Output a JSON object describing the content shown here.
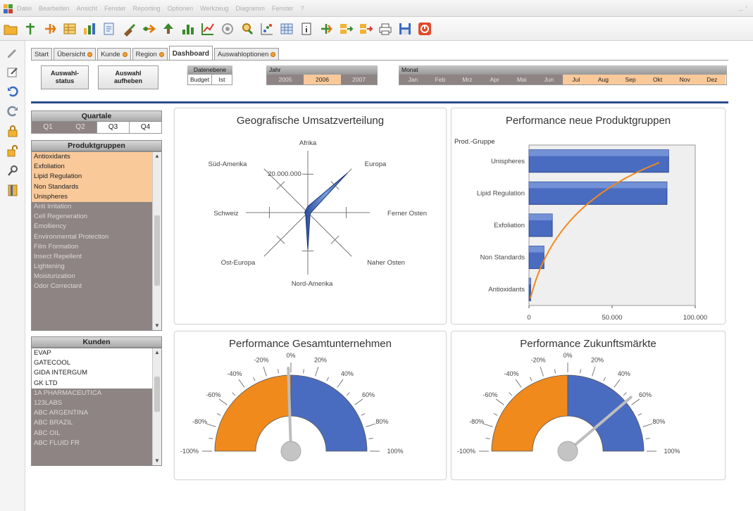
{
  "menubar": {
    "items": [
      "Datei",
      "Bearbeiten",
      "Ansicht",
      "Fenster",
      "Reporting",
      "Optionen",
      "Werkzeug",
      "Diagramm",
      "Fenster",
      "?"
    ],
    "window_controls": "_ ▫"
  },
  "toolbar_icons": [
    "open-folder-icon",
    "pin-icon",
    "tag-icon",
    "table-icon",
    "chart-icon",
    "document-icon",
    "brush-icon",
    "arrows-icon",
    "tree-icon",
    "bar-icon",
    "line-icon",
    "circle-icon",
    "magnify-icon",
    "scatter-icon",
    "grid-icon",
    "info-icon",
    "fork-icon",
    "export-icon",
    "export2-icon",
    "print-icon",
    "save-icon",
    "stop-icon"
  ],
  "tabs": [
    {
      "label": "Start",
      "dot": false,
      "active": false
    },
    {
      "label": "Übersicht",
      "dot": true,
      "active": false
    },
    {
      "label": "Kunde",
      "dot": true,
      "active": false
    },
    {
      "label": "Region",
      "dot": true,
      "active": false
    },
    {
      "label": "Dashboard",
      "dot": false,
      "active": true
    },
    {
      "label": "Auswahloptionen",
      "dot": true,
      "active": false
    }
  ],
  "buttons": {
    "auswahlstatus": "Auswahl-\nstatus",
    "auswahl_aufheben": "Auswahl\naufheben"
  },
  "datenebene": {
    "title": "Datenebene",
    "options": [
      "Budget",
      "Ist"
    ]
  },
  "jahr": {
    "title": "Jahr",
    "options": [
      "2005",
      "2006",
      "2007"
    ],
    "selected": "2006"
  },
  "monat": {
    "title": "Monat",
    "options": [
      "Jan",
      "Feb",
      "Mrz",
      "Apr",
      "Mai",
      "Jun",
      "Jul",
      "Aug",
      "Sep",
      "Okt",
      "Nov",
      "Dez"
    ],
    "selected": [
      "Jul",
      "Aug",
      "Sep",
      "Okt",
      "Nov",
      "Dez"
    ]
  },
  "quartale": {
    "title": "Quartale",
    "options": [
      "Q1",
      "Q2",
      "Q3",
      "Q4"
    ],
    "selected": [
      "Q3",
      "Q4"
    ]
  },
  "produktgruppen": {
    "title": "Produktgruppen",
    "selected": [
      "Antioxidants",
      "Exfoliation",
      "Lipid Regulation",
      "Non Standards",
      "Unispheres"
    ],
    "others": [
      "Anti Irritation",
      "Cell Regeneration",
      "Emolliency",
      "Environmental Protection",
      "Film Formation",
      "Insect Repellent",
      "Lightening",
      "Moisturization",
      "Odor Correctant"
    ]
  },
  "kunden": {
    "title": "Kunden",
    "selected": [
      "EVAP",
      "GATECOOL",
      "GIDA INTERGUM",
      "GK LTD"
    ],
    "others": [
      "1A PHARMACEUTICA",
      "123LABS",
      "ABC ARGENTINA",
      "ABC BRAZIL",
      "ABC OIL",
      "ABC FLUID FR"
    ]
  },
  "colors": {
    "orange": "#f08a1c",
    "blue": "#4a6cc0",
    "selected_bg": "#f9c99a",
    "grey_bg": "#8e8484",
    "accent_line": "#2d4c8c"
  },
  "chart_data": [
    {
      "type": "radar",
      "title": "Geografische Umsatzverteilung",
      "axes": [
        "Afrika",
        "Europa",
        "Ferner Osten",
        "Naher Osten",
        "Nord-Amerika",
        "Ost-Europa",
        "Schweiz",
        "Süd-Amerika"
      ],
      "scale_label": "20.000.000",
      "values": [
        2000000,
        18000000,
        1000000,
        1000000,
        12000000,
        1000000,
        1000000,
        1000000
      ]
    },
    {
      "type": "bar",
      "orientation": "horizontal",
      "title": "Performance neue Produktgruppen",
      "ylabel": "Prod.-Gruppe",
      "categories": [
        "Unispheres",
        "Lipid Regulation",
        "Exfoliation",
        "Non Standards",
        "Antioxidants"
      ],
      "values": [
        84000,
        83000,
        14000,
        9000,
        1000
      ],
      "ticks": [
        "0",
        "50.000",
        "100.000"
      ],
      "xlim": [
        0,
        100000
      ]
    },
    {
      "type": "gauge",
      "title": "Performance Gesamtunternehmen",
      "ticks": [
        "-100%",
        "-80%",
        "-60%",
        "-40%",
        "-20%",
        "0%",
        "20%",
        "40%",
        "60%",
        "80%",
        "100%"
      ],
      "value": -2
    },
    {
      "type": "gauge",
      "title": "Performance Zukunftsmärkte",
      "ticks": [
        "-100%",
        "-80%",
        "-60%",
        "-40%",
        "-20%",
        "0%",
        "20%",
        "40%",
        "60%",
        "80%",
        "100%"
      ],
      "value": 55
    }
  ]
}
